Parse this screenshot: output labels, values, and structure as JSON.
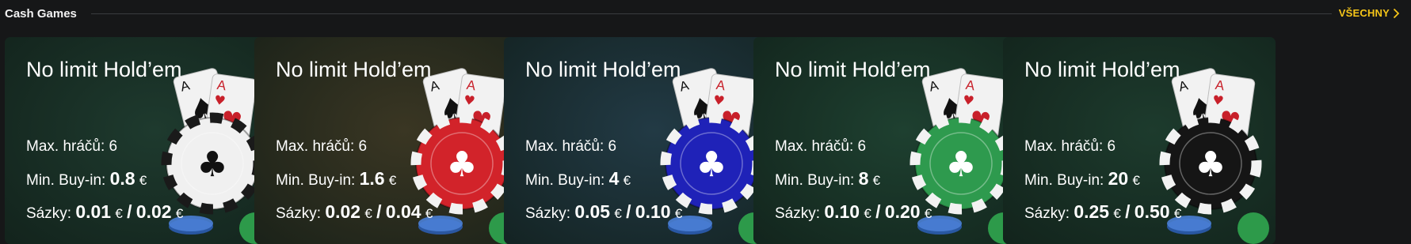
{
  "header": {
    "title": "Cash Games",
    "see_all": "VŠECHNY"
  },
  "labels": {
    "max_players": "Max. hráčů:",
    "min_buyin": "Min. Buy-in:",
    "stakes": "Sázky:",
    "currency": "€",
    "slash": "/"
  },
  "colors": {
    "accent": "#f5c518"
  },
  "cards": [
    {
      "title": "No limit Hold’em",
      "max_players": "6",
      "min_buyin": "0.8",
      "stake_small": "0.01",
      "stake_big": "0.02",
      "bg": "#1e3a2e",
      "chip": "#f0f0f0",
      "chip_stripe": "#1a1a1a",
      "chip_suit": "#111"
    },
    {
      "title": "No limit Hold’em",
      "max_players": "6",
      "min_buyin": "1.6",
      "stake_small": "0.02",
      "stake_big": "0.04",
      "bg": "#3a3623",
      "chip": "#d2232a",
      "chip_stripe": "#f2f2f2",
      "chip_suit": "#fff"
    },
    {
      "title": "No limit Hold’em",
      "max_players": "6",
      "min_buyin": "4",
      "stake_small": "0.05",
      "stake_big": "0.10",
      "bg": "#223a45",
      "chip": "#1f22b8",
      "chip_stripe": "#f2f2f2",
      "chip_suit": "#fff"
    },
    {
      "title": "No limit Hold’em",
      "max_players": "6",
      "min_buyin": "8",
      "stake_small": "0.10",
      "stake_big": "0.20",
      "bg": "#1e4030",
      "chip": "#2e9a4e",
      "chip_stripe": "#f2f2f2",
      "chip_suit": "#fff"
    },
    {
      "title": "No limit Hold’em",
      "max_players": "6",
      "min_buyin": "20",
      "stake_small": "0.25",
      "stake_big": "0.50",
      "bg": "#1d3b2d",
      "chip": "#151515",
      "chip_stripe": "#f2f2f2",
      "chip_suit": "#fff"
    }
  ]
}
